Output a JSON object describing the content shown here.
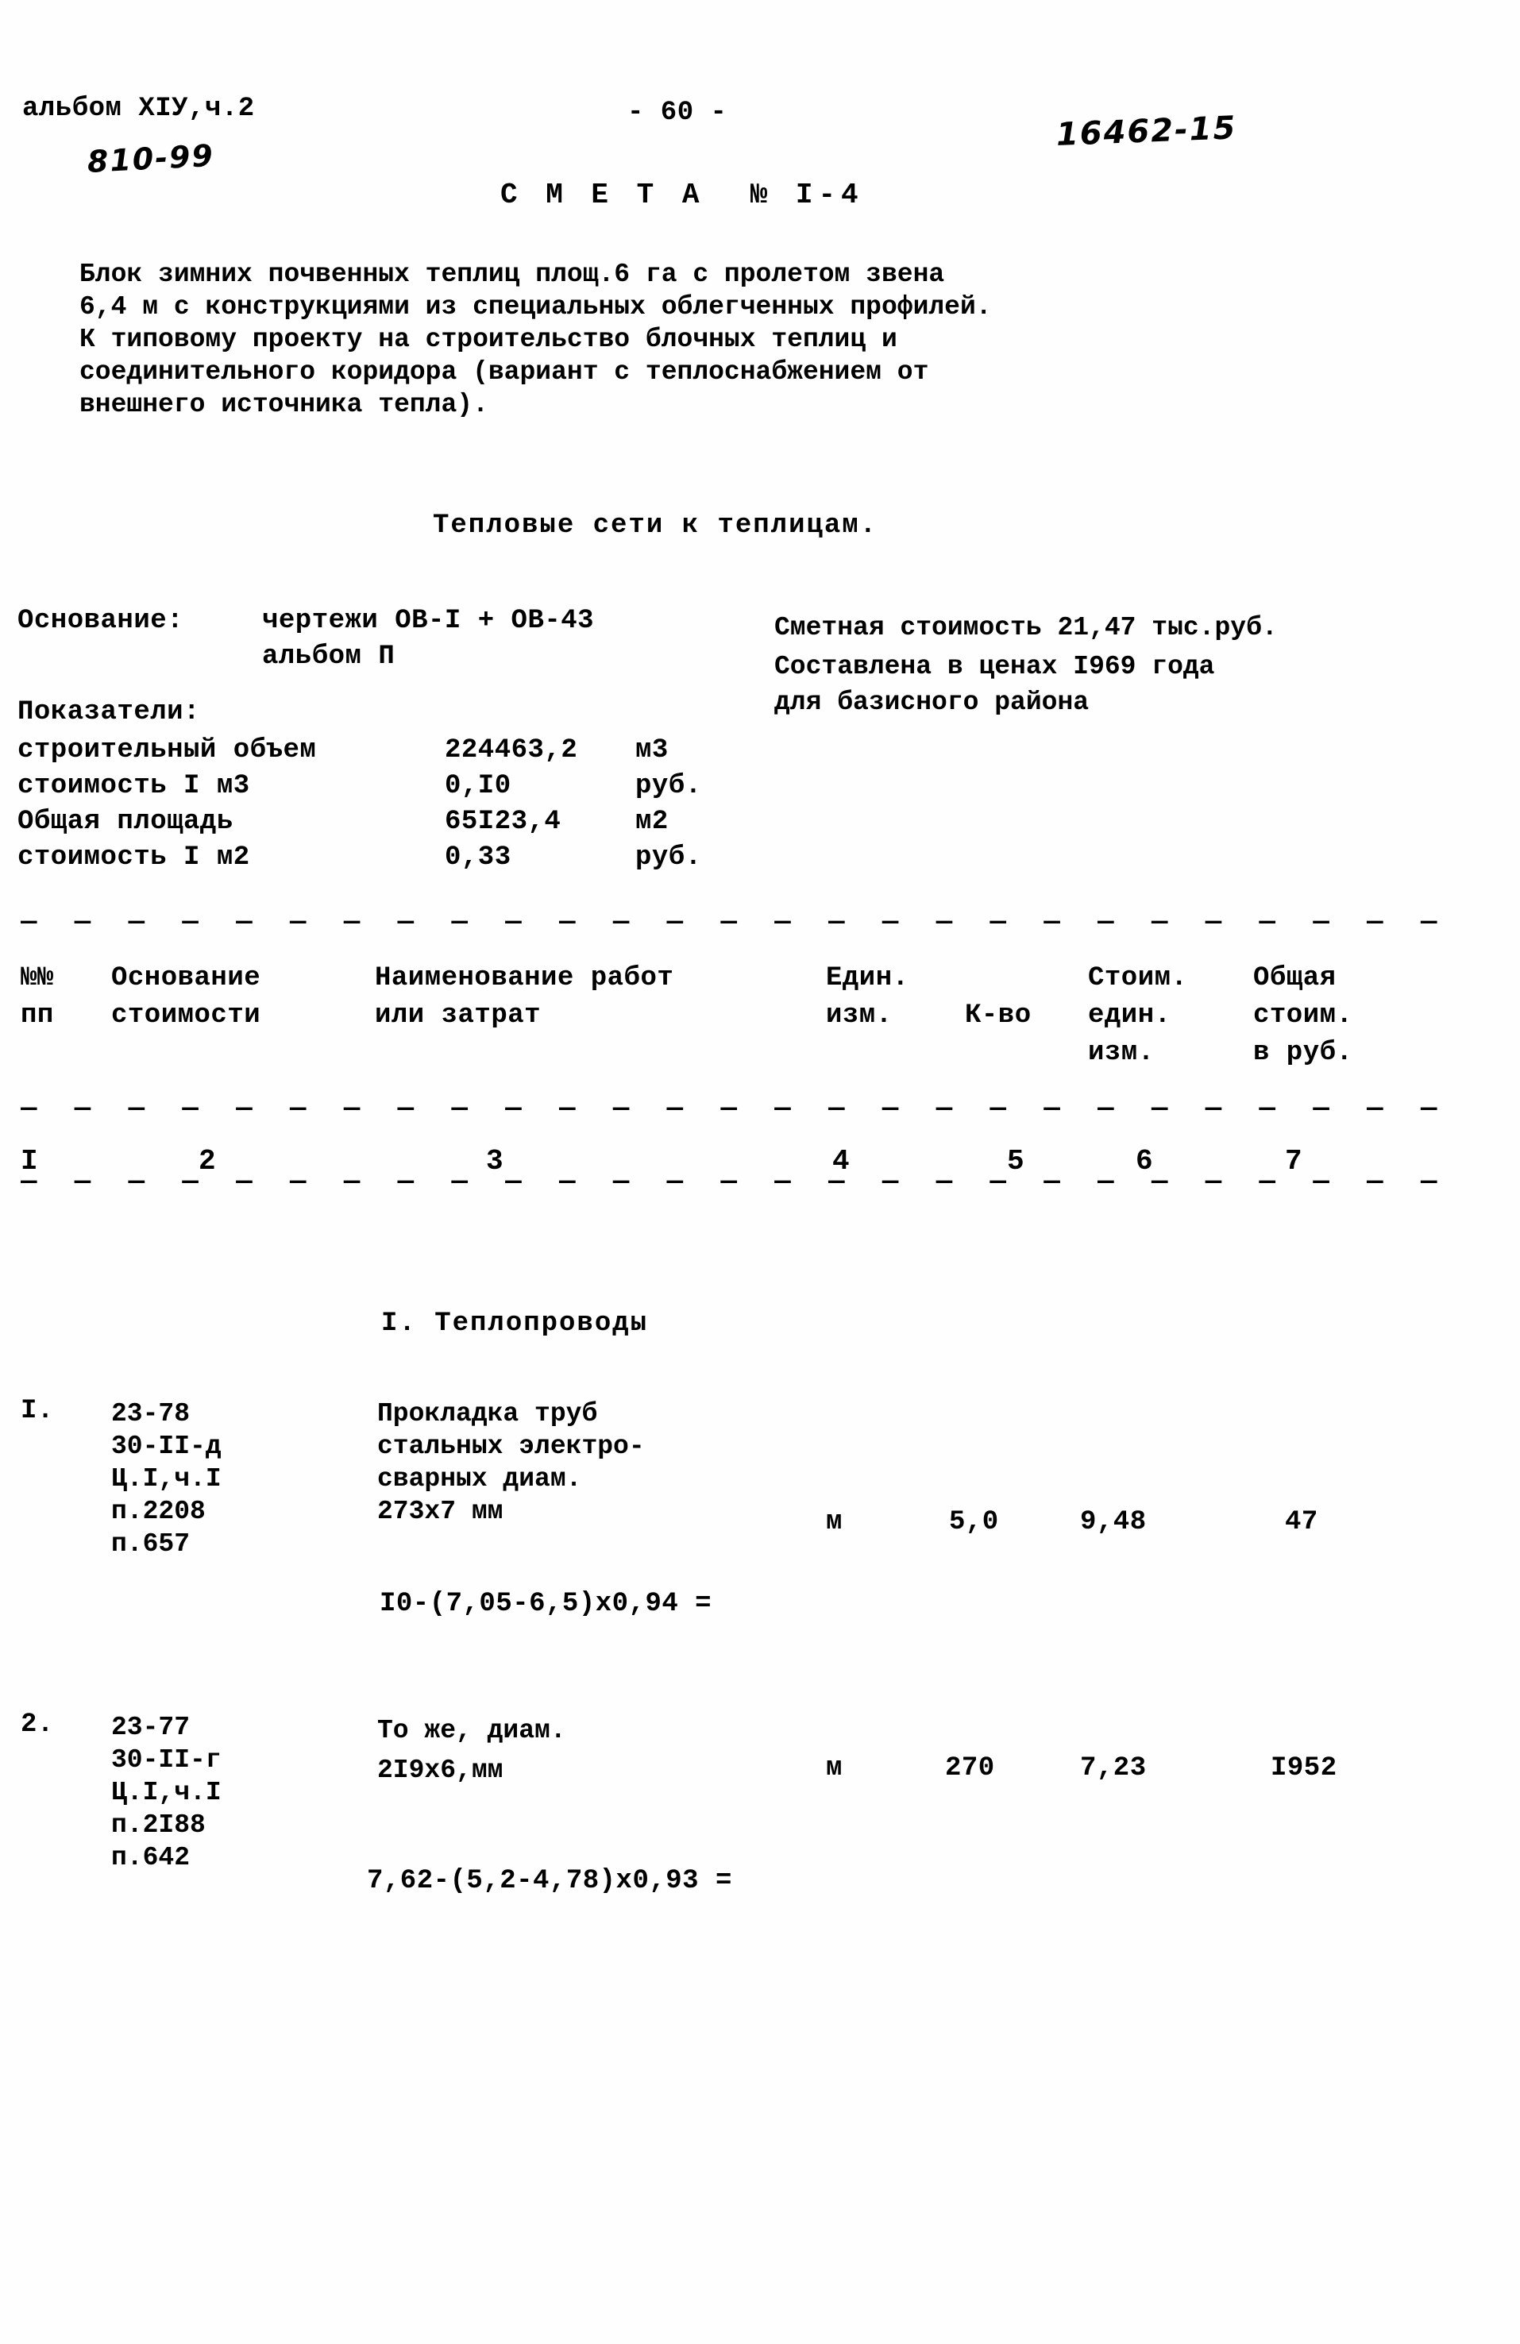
{
  "document": {
    "album_ref": "альбом XIУ,ч.2",
    "album_code": "810-99",
    "page_number": "- 60 -",
    "archive_number": "16462-15",
    "title": "С М Е Т А  № I-4"
  },
  "description": {
    "line1": "Блок зимних почвенных теплиц площ.6 га с пролетом звена",
    "line2": "6,4 м с конструкциями из специальных облегченных профилей.",
    "line3": "К типовому проекту на строительство блочных теплиц и",
    "line4": "соединительного коридора (вариант с теплоснабжением от",
    "line5": "внешнего источника тепла).",
    "subtitle": "Тепловые сети к теплицам."
  },
  "basis": {
    "label": "Основание:",
    "value_line1": "чертежи ОВ-I + ОВ-43",
    "value_line2": "альбом П"
  },
  "cost_summary": {
    "line1": "Сметная стоимость 21,47 тыс.руб.",
    "line2": "Составлена в ценах I969 года",
    "line3": "для базисного района"
  },
  "indicators": {
    "heading": "Показатели:",
    "rows": [
      {
        "name": "строительный объем",
        "value": "224463,2",
        "unit": "м3"
      },
      {
        "name": "стоимость I м3",
        "value": "0,I0",
        "unit": "руб."
      },
      {
        "name": "Общая площадь",
        "value": "65I23,4",
        "unit": "м2"
      },
      {
        "name": "стоимость I м2",
        "value": "0,33",
        "unit": "руб."
      }
    ]
  },
  "table": {
    "headers": {
      "col1_line1": "№№",
      "col1_line2": "пп",
      "col2_line1": "Основание",
      "col2_line2": "стоимости",
      "col3_line1": "Наименование работ",
      "col3_line2": "или затрат",
      "col4_line1": "Един.",
      "col4_line2": "изм.",
      "col5_line1": "К-во",
      "col6_line1": "Стоим.",
      "col6_line2": "един.",
      "col6_line3": "изм.",
      "col7_line1": "Общая",
      "col7_line2": "стоим.",
      "col7_line3": "в руб."
    },
    "column_numbers": [
      "I",
      "2",
      "3",
      "4",
      "5",
      "6",
      "7"
    ],
    "section_title": "I. Теплопроводы",
    "rows": [
      {
        "num": "I.",
        "basis_lines": [
          "23-78",
          "30-II-д",
          "Ц.I,ч.I",
          "п.2208",
          "п.657"
        ],
        "work_lines": [
          "Прокладка труб",
          "стальных электро-",
          "сварных диам.",
          "273х7 мм"
        ],
        "unit": "м",
        "qty": "5,0",
        "unit_cost": "9,48",
        "total_cost": "47",
        "formula": "I0-(7,05-6,5)х0,94 ="
      },
      {
        "num": "2.",
        "basis_lines": [
          "23-77",
          "30-II-г",
          "Ц.I,ч.I",
          "п.2I88",
          "п.642"
        ],
        "work_lines": [
          "То же, диам.",
          "2I9х6,мм"
        ],
        "unit": "м",
        "qty": "270",
        "unit_cost": "7,23",
        "total_cost": "I952",
        "formula": "7,62-(5,2-4,78)х0,93 ="
      }
    ]
  },
  "rules": {
    "dash_char": "— — — — — — — — — — — — — — — — — — — — — — — — — — — — — — — — — — —"
  }
}
